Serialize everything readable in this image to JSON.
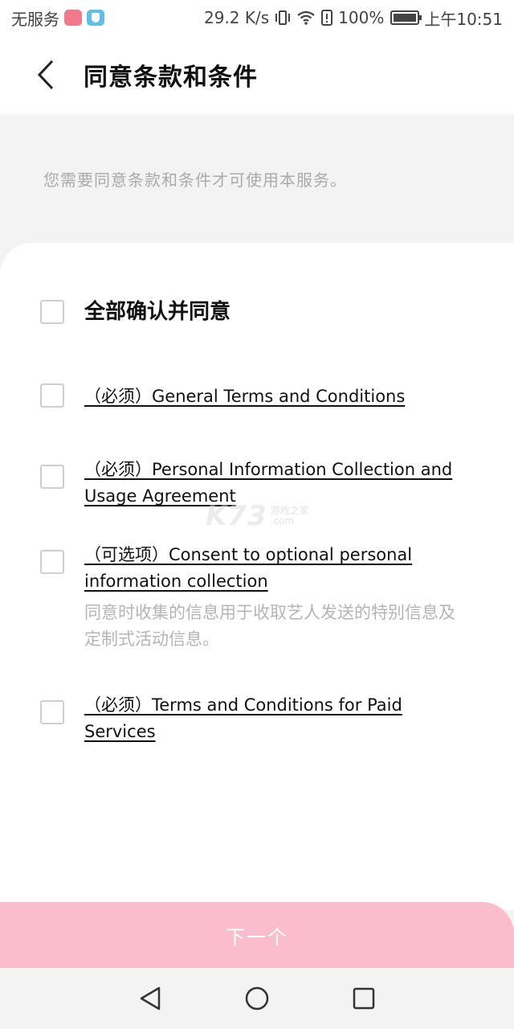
{
  "status_bar": {
    "carrier": "无服务",
    "speed": "29.2 K/s",
    "battery": "100%",
    "time": "上午10:51"
  },
  "header": {
    "title": "同意条款和条件"
  },
  "notice": "您需要同意条款和条件才可使用本服务。",
  "agree_all": {
    "label": "全部确认并同意"
  },
  "terms": [
    {
      "label": "（必须）General Terms and Conditions",
      "description": ""
    },
    {
      "label": "（必须）Personal Information Collection and Usage Agreement",
      "description": ""
    },
    {
      "label": "（可选项）Consent to optional personal information collection",
      "description": "同意时收集的信息用于收取艺人发送的特别信息及定制式活动信息。"
    },
    {
      "label": "（必须）Terms and Conditions for Paid Services",
      "description": ""
    }
  ],
  "watermark": {
    "brand": "K73",
    "line1": "游戏之家",
    "line2": ".com"
  },
  "next_button": {
    "label": "下一个"
  },
  "colors": {
    "accent": "#fbbccb",
    "background": "#f3f3f3",
    "card": "#ffffff"
  }
}
